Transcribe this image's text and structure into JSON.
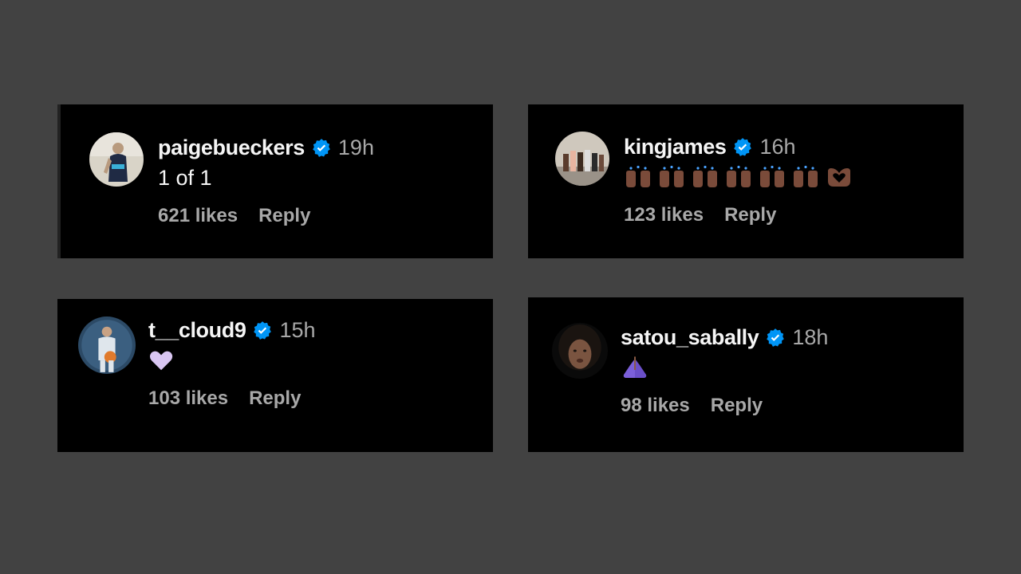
{
  "colors": {
    "background": "#424242",
    "card": "#000000",
    "verified_blue": "#0095f6",
    "primary_text": "#f5f5f5",
    "secondary_text": "#a8a8a8"
  },
  "comments": [
    {
      "username": "paigebueckers",
      "verified": true,
      "time": "19h",
      "text": "1 of 1",
      "likes": "621 likes",
      "reply": "Reply",
      "avatar_icon": "avatar-photo"
    },
    {
      "username": "kingjames",
      "verified": true,
      "time": "16h",
      "emojis": [
        "raising-hands-emoji",
        "raising-hands-emoji",
        "raising-hands-emoji",
        "raising-hands-emoji",
        "raising-hands-emoji",
        "raising-hands-emoji",
        "heart-hands-emoji"
      ],
      "likes": "123 likes",
      "reply": "Reply",
      "avatar_icon": "avatar-photo"
    },
    {
      "username": "t__cloud9",
      "verified": true,
      "time": "15h",
      "emojis": [
        "light-purple-heart-emoji"
      ],
      "likes": "103 likes",
      "reply": "Reply",
      "avatar_icon": "avatar-photo"
    },
    {
      "username": "satou_sabally",
      "verified": true,
      "time": "18h",
      "emojis": [
        "folded-hands-emoji"
      ],
      "likes": "98 likes",
      "reply": "Reply",
      "avatar_icon": "avatar-photo"
    }
  ]
}
